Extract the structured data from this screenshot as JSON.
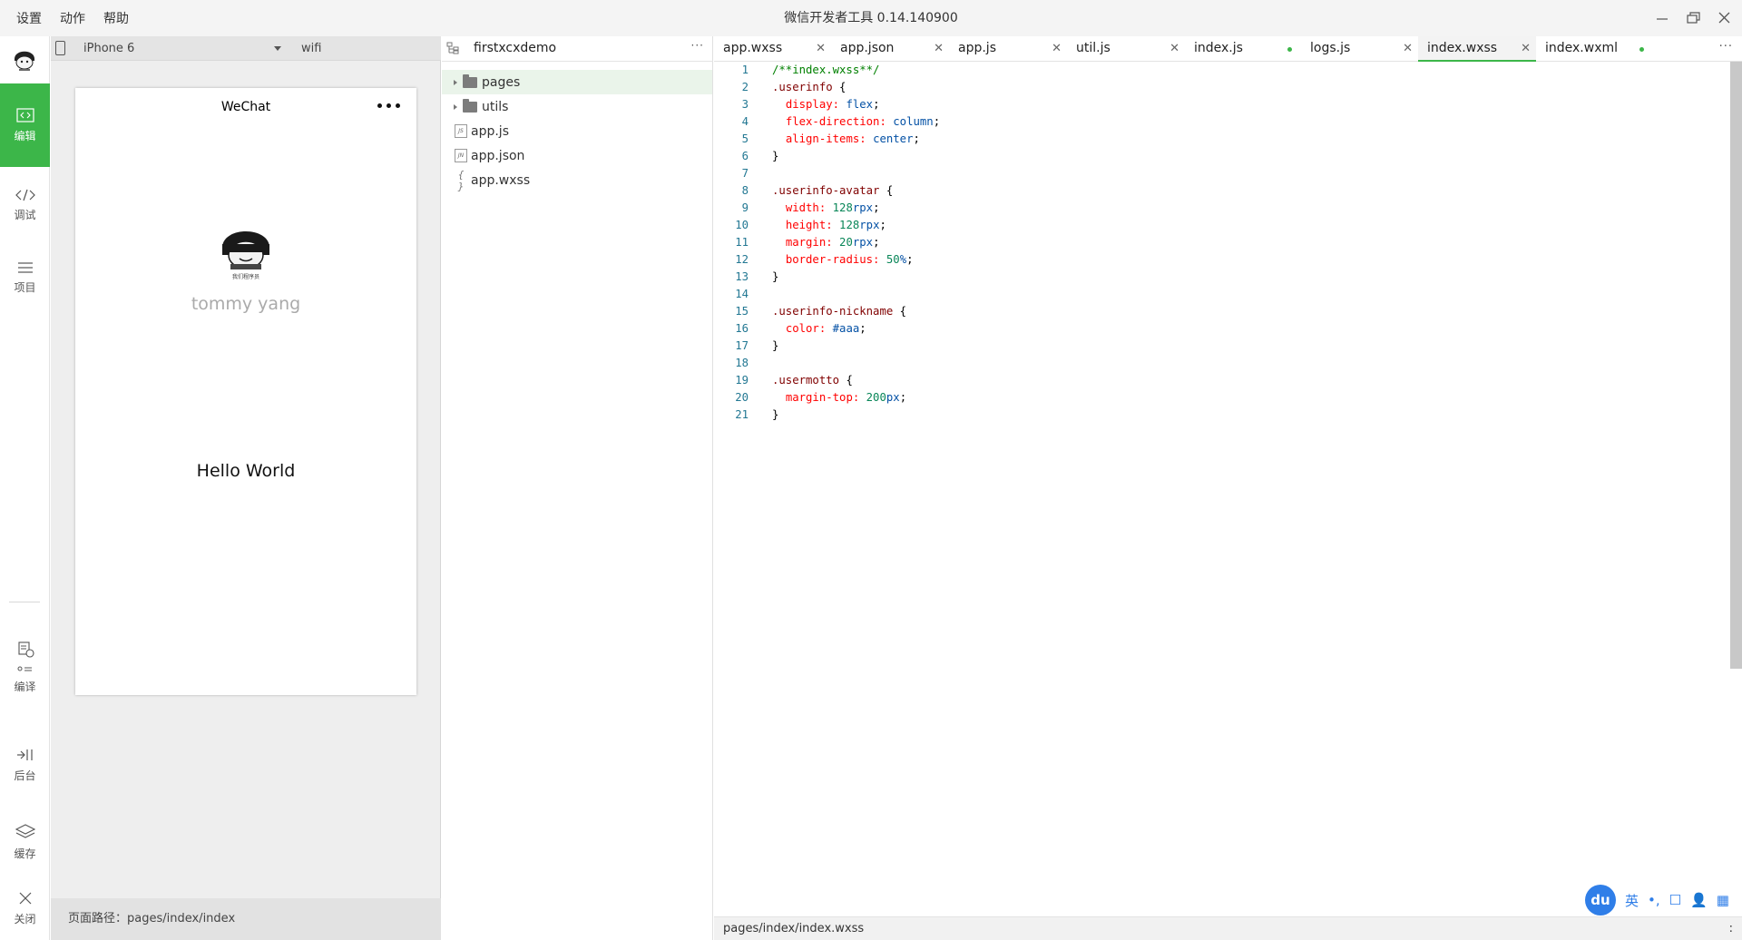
{
  "window": {
    "title": "微信开发者工具 0.14.140900",
    "menu": [
      "设置",
      "动作",
      "帮助"
    ]
  },
  "leftnav": {
    "items": [
      {
        "label": "编辑",
        "icon": "code-icon",
        "active": true
      },
      {
        "label": "调试",
        "icon": "debug-icon",
        "active": false
      },
      {
        "label": "项目",
        "icon": "menu-icon",
        "active": false
      },
      {
        "label": "编译",
        "icon": "compile-icon",
        "active": false
      },
      {
        "label": "后台",
        "icon": "background-icon",
        "active": false
      },
      {
        "label": "缓存",
        "icon": "layers-icon",
        "active": false
      },
      {
        "label": "关闭",
        "icon": "close-icon",
        "active": false
      }
    ]
  },
  "simulator": {
    "device": "iPhone 6",
    "network": "wifi",
    "page_title": "WeChat",
    "nickname": "tommy yang",
    "motto": "Hello World",
    "avatar_caption": "我们程序员",
    "path_label": "页面路径：pages/index/index"
  },
  "filetree": {
    "project": "firstxcxdemo",
    "items": [
      {
        "name": "pages",
        "type": "folder",
        "selected": true
      },
      {
        "name": "utils",
        "type": "folder",
        "selected": false
      },
      {
        "name": "app.js",
        "type": "js",
        "badge": "JS"
      },
      {
        "name": "app.json",
        "type": "json",
        "badge": "JN"
      },
      {
        "name": "app.wxss",
        "type": "wxss",
        "badge": "{ }"
      }
    ]
  },
  "editor": {
    "tabs": [
      {
        "label": "app.wxss",
        "state": "close"
      },
      {
        "label": "app.json",
        "state": "close"
      },
      {
        "label": "app.js",
        "state": "close"
      },
      {
        "label": "util.js",
        "state": "close"
      },
      {
        "label": "index.js",
        "state": "modified"
      },
      {
        "label": "logs.js",
        "state": "close"
      },
      {
        "label": "index.wxss",
        "state": "close",
        "active": true
      },
      {
        "label": "index.wxml",
        "state": "modified"
      }
    ],
    "lines": [
      "/**index.wxss**/",
      ".userinfo {",
      "  display: flex;",
      "  flex-direction: column;",
      "  align-items: center;",
      "}",
      "",
      ".userinfo-avatar {",
      "  width: 128rpx;",
      "  height: 128rpx;",
      "  margin: 20rpx;",
      "  border-radius: 50%;",
      "}",
      "",
      ".userinfo-nickname {",
      "  color: #aaa;",
      "}",
      "",
      ".usermotto {",
      "  margin-top: 200px;",
      "}"
    ],
    "status_path": "pages/index/index.wxss",
    "status_right": ":"
  },
  "ime": {
    "logo": "du",
    "items": [
      "英",
      "•,",
      "☐",
      "👤",
      "▦"
    ]
  },
  "colors": {
    "accent": "#3cb649",
    "ime_blue": "#2f7ee8"
  }
}
